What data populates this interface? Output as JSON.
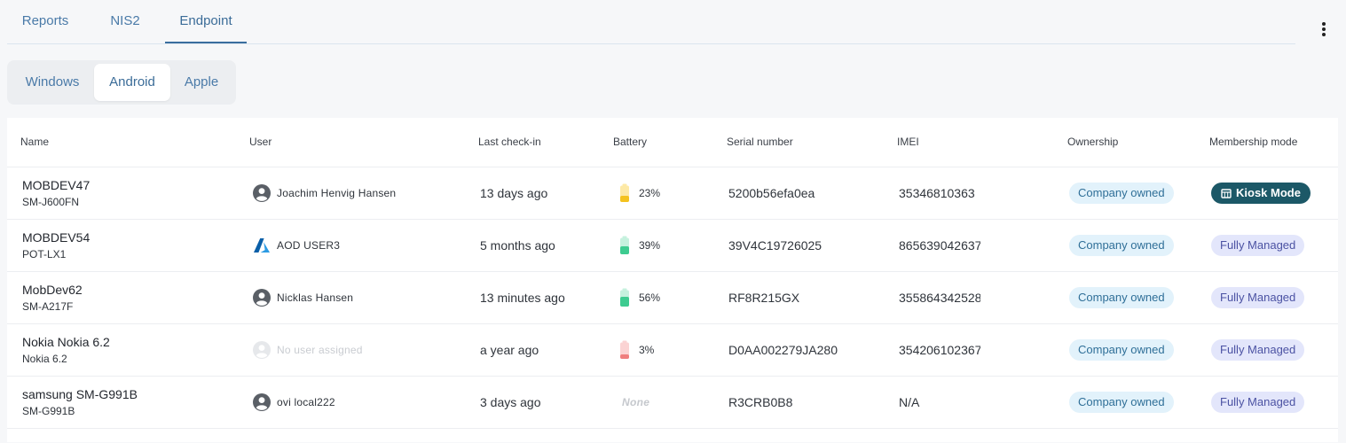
{
  "tabs": [
    {
      "label": "Reports",
      "active": false
    },
    {
      "label": "NIS2",
      "active": false
    },
    {
      "label": "Endpoint",
      "active": true
    }
  ],
  "platform_tabs": [
    {
      "label": "Windows",
      "active": false
    },
    {
      "label": "Android",
      "active": true
    },
    {
      "label": "Apple",
      "active": false
    }
  ],
  "columns": [
    "Name",
    "User",
    "Last check-in",
    "Battery",
    "Serial number",
    "IMEI",
    "Ownership",
    "Membership mode"
  ],
  "rows": [
    {
      "name": "MOBDEV47",
      "model": "SM-J600FN",
      "user": "Joachim Henvig Hansen",
      "user_icon": "person-icon",
      "checkin": "13 days ago",
      "battery": "23%",
      "battery_level": 0.23,
      "serial": "5200b56efa0ea",
      "imei": "35346810363",
      "ownership": "Company owned",
      "mode": "Kiosk Mode"
    },
    {
      "name": "MOBDEV54",
      "model": "POT-LX1",
      "user": "AOD USER3",
      "user_icon": "azure-icon",
      "checkin": "5 months ago",
      "battery": "39%",
      "battery_level": 0.39,
      "serial": "39V4C19726025",
      "imei": "865639042637",
      "ownership": "Company owned",
      "mode": "Fully Managed"
    },
    {
      "name": "MobDev62",
      "model": "SM-A217F",
      "user": "Nicklas Hansen",
      "user_icon": "person-icon",
      "checkin": "13 minutes ago",
      "battery": "56%",
      "battery_level": 0.56,
      "serial": "RF8R215GX",
      "imei": "355864342528",
      "ownership": "Company owned",
      "mode": "Fully Managed"
    },
    {
      "name": "Nokia Nokia 6.2",
      "model": "Nokia 6.2",
      "user": "No user assigned",
      "user_icon": "person-icon",
      "checkin": "a year ago",
      "battery": "3%",
      "battery_level": 0.03,
      "serial": "D0AA002279JA280",
      "imei": "354206102367",
      "ownership": "Company owned",
      "mode": "Fully Managed"
    },
    {
      "name": "samsung SM-G991B",
      "model": "SM-G991B",
      "user": "ovi local222",
      "user_icon": "person-icon",
      "checkin": "3 days ago",
      "battery": "None",
      "battery_level": null,
      "serial": "R3CRB0B8",
      "imei": "N/A",
      "ownership": "Company owned",
      "mode": "Fully Managed"
    }
  ],
  "colors": {
    "accent": "#3b6c98",
    "battery_low": "#f4c21f",
    "battery_ok": "#3ecb90",
    "battery_critical": "#ef7e7e",
    "kiosk": "#1c5867",
    "managed": "#e3e6fb",
    "owned": "#e2f2fb"
  }
}
